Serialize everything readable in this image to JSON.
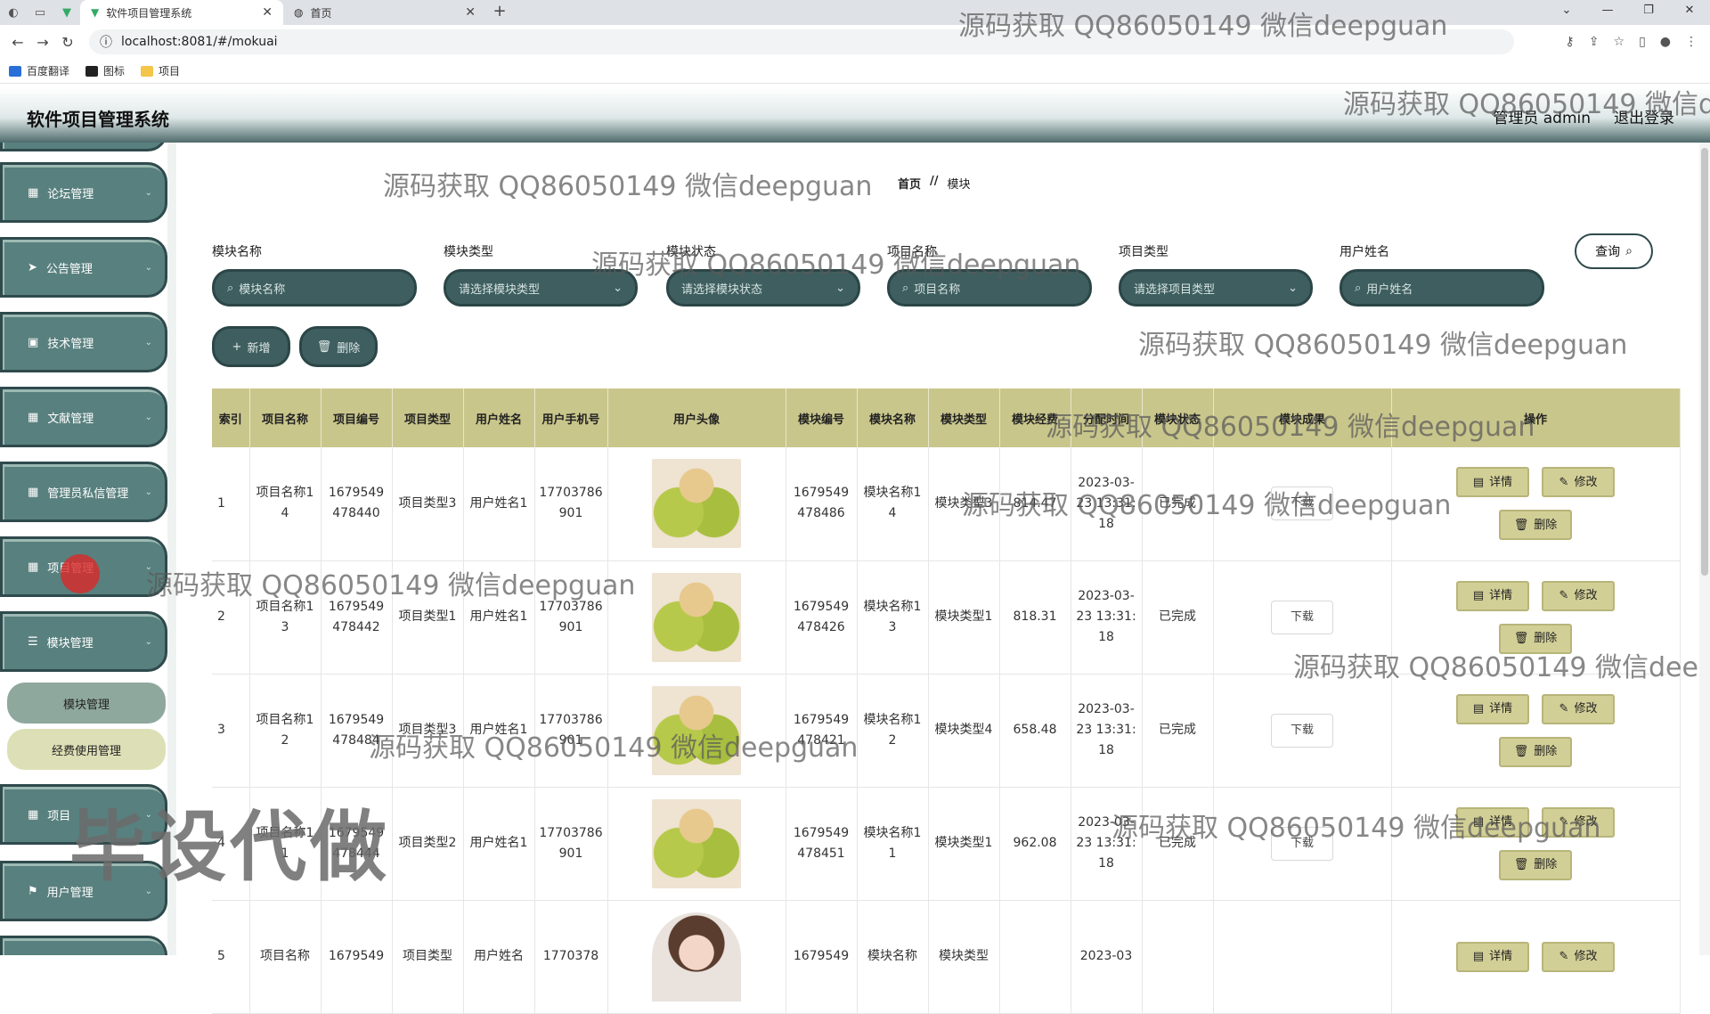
{
  "browser": {
    "tabs": [
      {
        "title": "软件项目管理系统",
        "active": true
      },
      {
        "title": "首页",
        "active": false
      }
    ],
    "url": "localhost:8081/#/mokuai",
    "bookmarks": [
      "百度翻译",
      "图标",
      "项目"
    ],
    "window_controls": [
      "⌄",
      "—",
      "❐",
      "✕"
    ]
  },
  "app": {
    "title": "软件项目管理系统",
    "user_label": "管理员 admin",
    "logout_label": "退出登录"
  },
  "sidebar": {
    "items": [
      {
        "label": "论坛管理",
        "icon": "grid-icon"
      },
      {
        "label": "公告管理",
        "icon": "send-icon"
      },
      {
        "label": "技术管理",
        "icon": "clipboard-icon"
      },
      {
        "label": "文献管理",
        "icon": "grid-icon"
      },
      {
        "label": "管理员私信管理",
        "icon": "grid-icon"
      },
      {
        "label": "项目管理",
        "icon": "grid-icon"
      },
      {
        "label": "模块管理",
        "icon": "sliders-icon"
      }
    ],
    "subitems": [
      {
        "label": "模块管理",
        "active": true
      },
      {
        "label": "经费使用管理",
        "active": false
      }
    ],
    "items_after": [
      {
        "label": "项目",
        "icon": "grid-icon"
      },
      {
        "label": "用户管理",
        "icon": "flag-icon"
      }
    ]
  },
  "breadcrumb": {
    "home": "首页",
    "sep": "//",
    "current": "模块"
  },
  "filters": [
    {
      "label": "模块名称",
      "placeholder": "模块名称",
      "kind": "search"
    },
    {
      "label": "模块类型",
      "placeholder": "请选择模块类型",
      "kind": "select"
    },
    {
      "label": "模块状态",
      "placeholder": "请选择模块状态",
      "kind": "select"
    },
    {
      "label": "项目名称",
      "placeholder": "项目名称",
      "kind": "search"
    },
    {
      "label": "项目类型",
      "placeholder": "请选择项目类型",
      "kind": "select"
    },
    {
      "label": "用户姓名",
      "placeholder": "用户姓名",
      "kind": "search"
    }
  ],
  "actions": {
    "query": "查询",
    "add": "新增",
    "delete": "删除"
  },
  "table": {
    "headers": [
      "索引",
      "项目名称",
      "项目编号",
      "项目类型",
      "用户姓名",
      "用户手机号",
      "用户头像",
      "模块编号",
      "模块名称",
      "模块类型",
      "模块经费",
      "分配时间",
      "模块状态",
      "模块成果",
      "操作"
    ],
    "rows": [
      {
        "idx": "1",
        "pname": "项目名称14",
        "pno": "1679549478440",
        "ptype": "项目类型3",
        "uname": "用户姓名1",
        "phone": "17703786901",
        "mno": "1679549478486",
        "mname": "模块名称14",
        "mtype": "模块类型3",
        "fund": "814.47",
        "time": "2023-03-23 13:31:18",
        "status": "已完成",
        "result": "下载"
      },
      {
        "idx": "2",
        "pname": "项目名称13",
        "pno": "1679549478442",
        "ptype": "项目类型1",
        "uname": "用户姓名1",
        "phone": "17703786901",
        "mno": "1679549478426",
        "mname": "模块名称13",
        "mtype": "模块类型1",
        "fund": "818.31",
        "time": "2023-03-23 13:31:18",
        "status": "已完成",
        "result": "下载"
      },
      {
        "idx": "3",
        "pname": "项目名称12",
        "pno": "1679549478484",
        "ptype": "项目类型3",
        "uname": "用户姓名1",
        "phone": "17703786901",
        "mno": "1679549478421",
        "mname": "模块名称12",
        "mtype": "模块类型4",
        "fund": "658.48",
        "time": "2023-03-23 13:31:18",
        "status": "已完成",
        "result": "下载"
      },
      {
        "idx": "4",
        "pname": "项目名称11",
        "pno": "1679549478444",
        "ptype": "项目类型2",
        "uname": "用户姓名1",
        "phone": "17703786901",
        "mno": "1679549478451",
        "mname": "模块名称11",
        "mtype": "模块类型1",
        "fund": "962.08",
        "time": "2023-03-23 13:31:18",
        "status": "已完成",
        "result": "下载"
      },
      {
        "idx": "5",
        "pname": "项目名称",
        "pno": "1679549",
        "ptype": "项目类型",
        "uname": "用户姓名",
        "phone": "1770378",
        "mno": "1679549",
        "mname": "模块名称",
        "mtype": "模块类型",
        "fund": "",
        "time": "2023-03",
        "status": "",
        "result": ""
      }
    ],
    "row_actions": {
      "detail": "详情",
      "edit": "修改",
      "delete": "删除"
    }
  },
  "watermarks": [
    "源码获取 QQ86050149 微信deepguan",
    "毕设代做"
  ]
}
